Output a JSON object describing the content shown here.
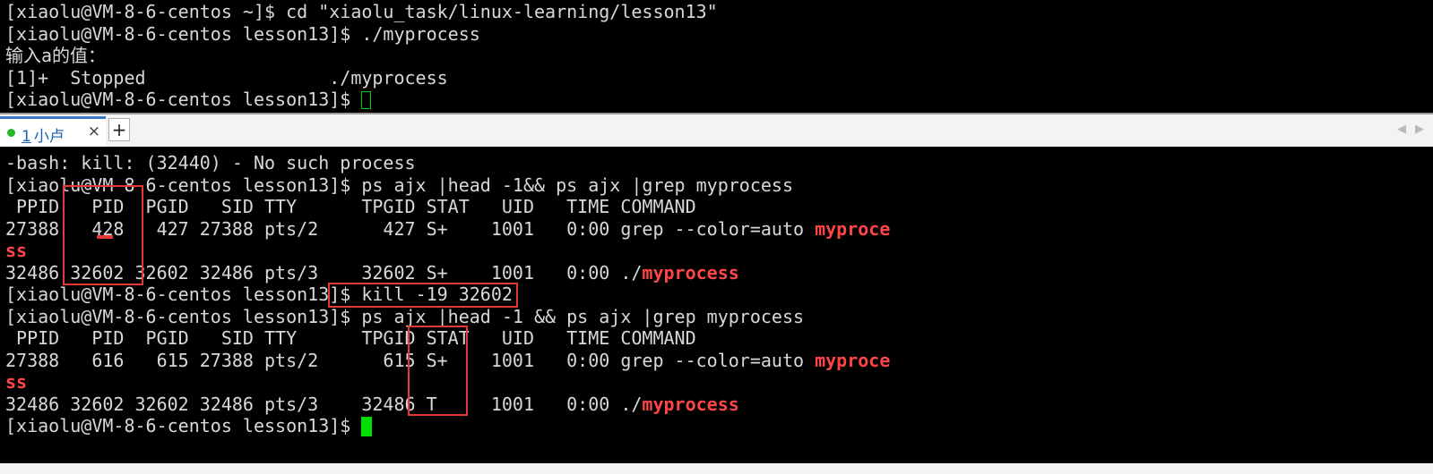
{
  "top_terminal": {
    "lines": [
      "[xiaolu@VM-8-6-centos ~]$ cd \"xiaolu_task/linux-learning/lesson13\"",
      "[xiaolu@VM-8-6-centos lesson13]$ ./myprocess",
      "输入a的值：",
      "[1]+  Stopped                 ./myprocess",
      "[xiaolu@VM-8-6-centos lesson13]$ "
    ]
  },
  "tabbar": {
    "tab_number": "1",
    "tab_name": "小卢",
    "close_symbol": "×",
    "add_symbol": "+",
    "scroll_left": "◀",
    "scroll_right": "▶"
  },
  "bottom_terminal": {
    "lines": [
      "-bash: kill: (32440) - No such process",
      "[xiaolu@VM-8-6-centos lesson13]$ ps ajx |head -1&& ps ajx |grep myprocess",
      " PPID   PID  PGID   SID TTY      TPGID STAT   UID   TIME COMMAND",
      "27388   428   427 27388 pts/2      427 S+    1001   0:00 grep --color=auto ",
      "",
      "32486 32602 32602 32486 pts/3    32602 S+    1001   0:00 ./",
      "[xiaolu@VM-8-6-centos lesson13]$ kill -19 32602",
      "[xiaolu@VM-8-6-centos lesson13]$ ps ajx |head -1 && ps ajx |grep myprocess",
      " PPID   PID  PGID   SID TTY      TPGID STAT   UID   TIME COMMAND",
      "27388   616   615 27388 pts/2      615 S+    1001   0:00 grep --color=auto ",
      "",
      "32486 32602 32602 32486 pts/3    32486 T     1001   0:00 ./",
      "[xiaolu@VM-8-6-centos lesson13]$ "
    ],
    "highlights": {
      "line3": "myproce",
      "line4": "ss",
      "line5": "myprocess",
      "line9": "myproce",
      "line10": "ss",
      "line11": "myprocess"
    }
  },
  "colors": {
    "terminal_bg": "#000000",
    "terminal_fg": "#d8d8d8",
    "grep_highlight": "#ff4545",
    "cursor": "#00e000",
    "annotation": "#e53935",
    "tab_accent": "#3a78c9"
  }
}
